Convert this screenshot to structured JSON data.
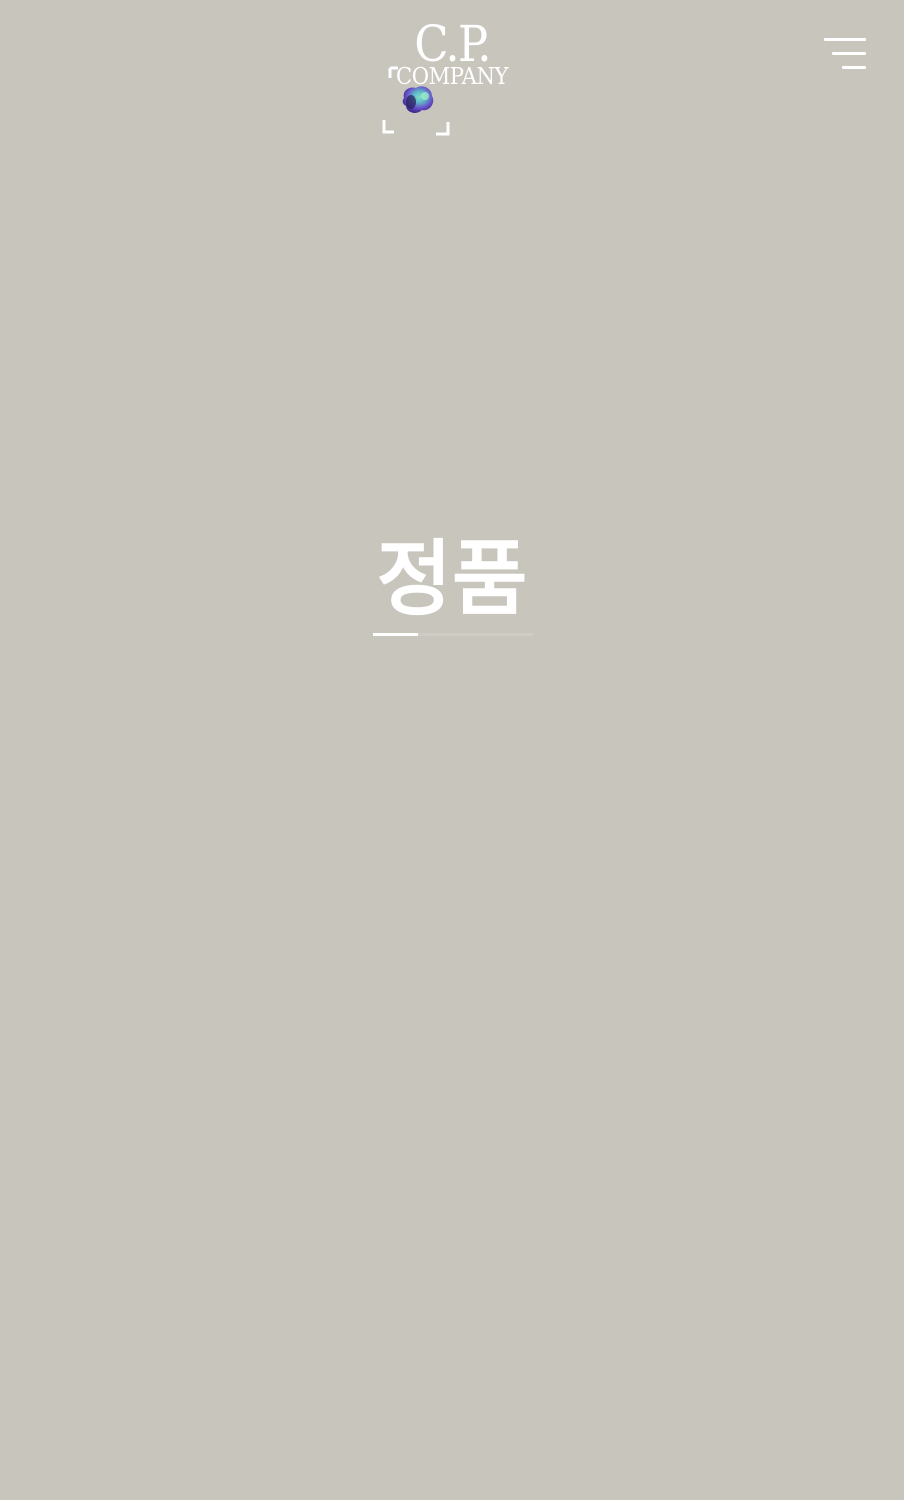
{
  "header": {
    "logo_line1": "C.P.",
    "logo_line2": "COMPANY",
    "logo_icon": "scan-frame-icon",
    "menu_icon": "hamburger-menu-icon"
  },
  "main": {
    "title": "정품",
    "progress_fraction": 0.28
  },
  "colors": {
    "background": "#c8c5bd",
    "foreground": "#ffffff",
    "orb_purple": "#6a4fc8",
    "orb_teal": "#5fc3b8"
  }
}
